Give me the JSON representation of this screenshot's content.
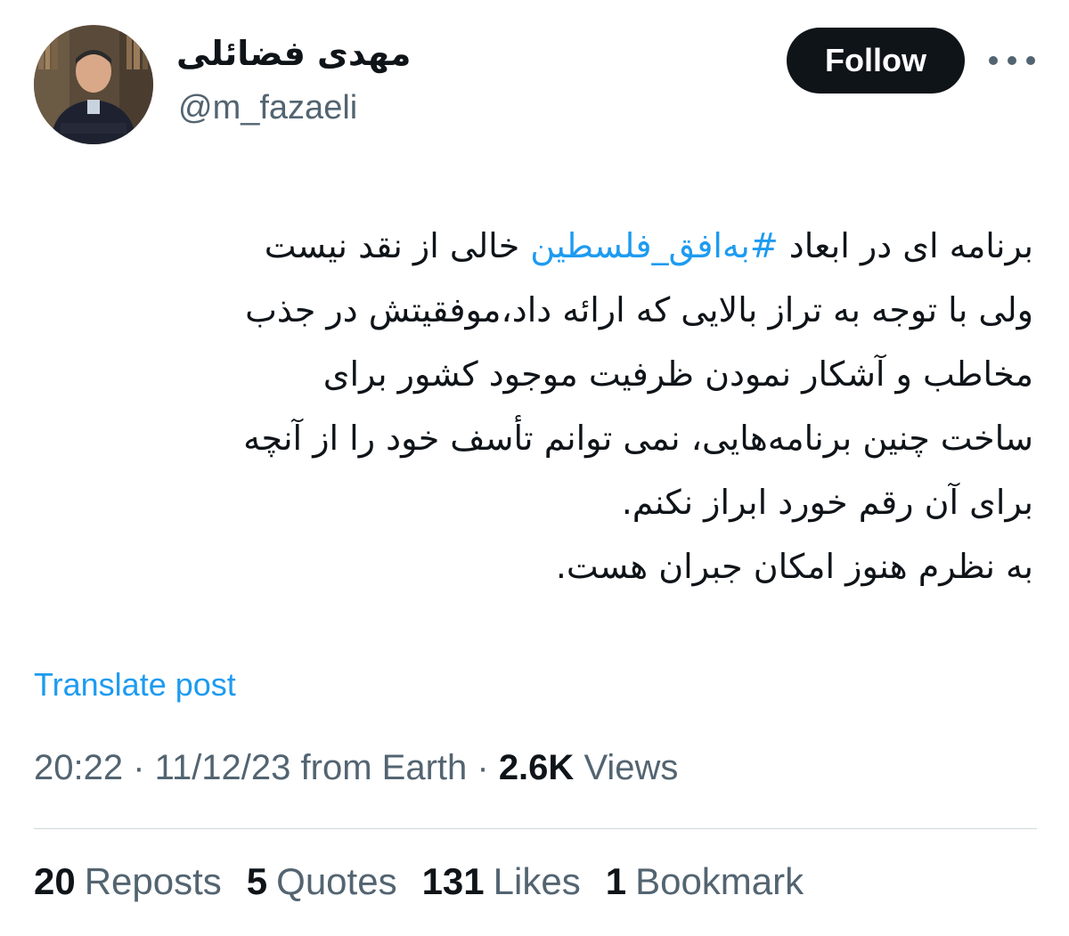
{
  "author": {
    "name": "مهدی فضائلی",
    "handle": "@m_fazaeli"
  },
  "actions": {
    "follow_label": "Follow",
    "more_icon": "more-horizontal-icon"
  },
  "post": {
    "lines": [
      [
        "برنامه ای در ابعاد ",
        "#به‌افق_فلسطین",
        " خالی از نقد نیست"
      ],
      "ولی با توجه به تراز بالایی که ارائه داد،موفقیتش در جذب",
      "مخاطب و آشکار نمودن ظرفیت موجود کشور برای",
      "ساخت چنین برنامه‌هایی، نمی توانم تأسف خود را از آنچه",
      "برای آن رقم خورد ابراز نکنم.",
      "به نظرم هنوز امکان جبران هست."
    ],
    "hashtag": "#به‌افق_فلسطین",
    "translate_label": "Translate post"
  },
  "meta": {
    "time": "20:22",
    "date": "11/12/23",
    "source": "from Earth",
    "views_count": "2.6K",
    "views_label": "Views"
  },
  "stats": {
    "reposts": {
      "count": "20",
      "label": "Reposts"
    },
    "quotes": {
      "count": "5",
      "label": "Quotes"
    },
    "likes": {
      "count": "131",
      "label": "Likes"
    },
    "bookmarks": {
      "count": "1",
      "label": "Bookmark"
    }
  },
  "colors": {
    "accent": "#1d9bf0",
    "text_primary": "#0f1419",
    "text_secondary": "#536471",
    "divider": "#cfd9de"
  }
}
